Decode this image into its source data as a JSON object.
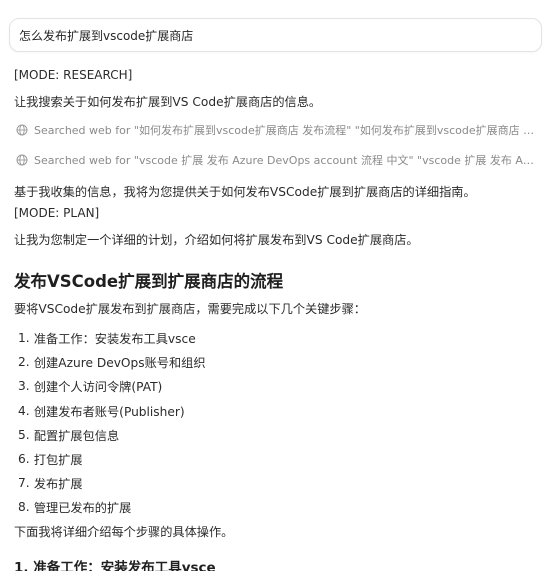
{
  "query": "怎么发布扩展到vscode扩展商店",
  "mode_research": "[MODE: RESEARCH]",
  "research_intro": "让我搜索关于如何发布扩展到VS Code扩展商店的信息。",
  "searches": [
    "Searched web for \"如何发布扩展到vscode扩展商店 发布流程\" \"如何发布扩展到vscode扩展商店 发布流程\"",
    "Searched web for \"vscode 扩展 发布 Azure DevOps account 流程 中文\" \"vscode 扩展 发布 Azure DevOps account 流程 中文\""
  ],
  "summary": "基于我收集的信息，我将为您提供关于如何发布VSCode扩展到扩展商店的详细指南。",
  "mode_plan": "[MODE: PLAN]",
  "plan_intro": "让我为您制定一个详细的计划，介绍如何将扩展发布到VS Code扩展商店。",
  "section_title": "发布VSCode扩展到扩展商店的流程",
  "section_intro": "要将VSCode扩展发布到扩展商店，需要完成以下几个关键步骤：",
  "steps": [
    {
      "num": "1.",
      "text": "准备工作：安装发布工具vsce"
    },
    {
      "num": "2.",
      "text": "创建Azure DevOps账号和组织"
    },
    {
      "num": "3.",
      "text": "创建个人访问令牌(PAT)"
    },
    {
      "num": "4.",
      "text": "创建发布者账号(Publisher)"
    },
    {
      "num": "5.",
      "text": "配置扩展包信息"
    },
    {
      "num": "6.",
      "text": "打包扩展"
    },
    {
      "num": "7.",
      "text": "发布扩展"
    },
    {
      "num": "8.",
      "text": "管理已发布的扩展"
    }
  ],
  "steps_outro": "下面我将详细介绍每个步骤的具体操作。",
  "subsection_title": "1. 准备工作：安装发布工具vsce",
  "icons": {
    "search": "globe-icon"
  }
}
